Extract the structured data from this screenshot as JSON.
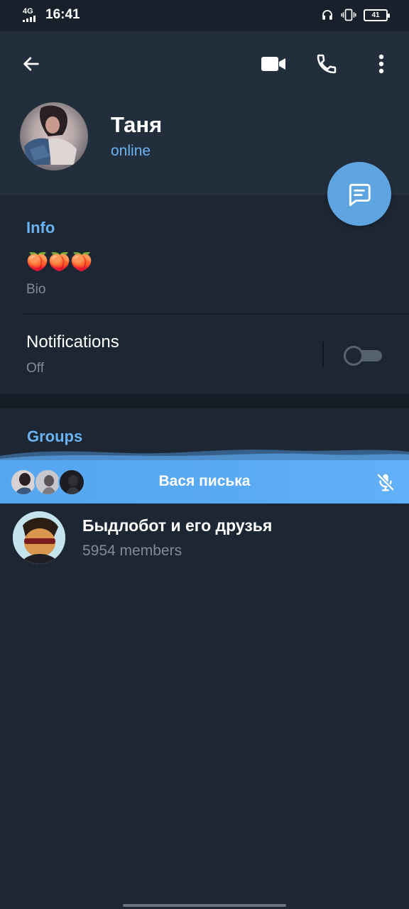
{
  "status_bar": {
    "network": "4G",
    "time": "16:41",
    "battery": "41"
  },
  "header": {
    "icons": [
      "back-arrow-icon",
      "video-call-icon",
      "phone-icon",
      "more-vertical-icon"
    ],
    "name": "Таня",
    "presence": "online",
    "fab_icon": "message-icon"
  },
  "info": {
    "title": "Info",
    "bio_value": "🍑🍑🍑",
    "bio_label": "Bio",
    "notifications_label": "Notifications",
    "notifications_status": "Off",
    "notifications_enabled": false
  },
  "groups": {
    "title": "Groups",
    "items": [
      {
        "name": "Быдлобот и его друзья",
        "members": "5954 members"
      }
    ]
  },
  "voice_chat": {
    "title": "Вася писька",
    "mic_icon": "mic-off-icon",
    "participant_count": 3
  },
  "colors": {
    "accent": "#6ab3f3",
    "header_bg": "#232e3c",
    "body_bg": "#1d2733",
    "call_bar": "#5aa9f3",
    "fab": "#5ea4e0"
  }
}
